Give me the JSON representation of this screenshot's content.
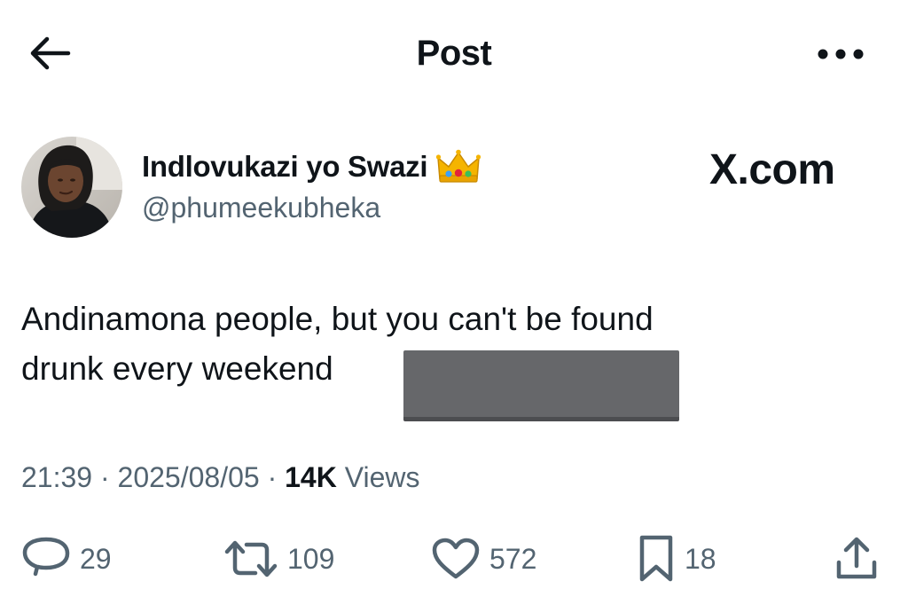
{
  "header": {
    "title": "Post",
    "back_icon": "arrow-left-icon",
    "more_icon": "more-horizontal-icon"
  },
  "author": {
    "display_name": "Indlovukazi yo Swazi",
    "badge_icon": "crown-emoji-icon",
    "handle": "@phumeekubheka"
  },
  "site_label": "X.com",
  "tweet": {
    "line1": "Andinamona people, but you can't be found",
    "line2": "drunk every weekend"
  },
  "meta": {
    "time": "21:39",
    "separator": "·",
    "date": "2025/08/05",
    "views_count": "14K",
    "views_label": "Views"
  },
  "actions": {
    "replies": "29",
    "reposts": "109",
    "likes": "572",
    "bookmarks": "18"
  },
  "colors": {
    "text": "#0f1419",
    "secondary": "#536471",
    "background": "#ffffff",
    "redaction": "#66676a"
  }
}
